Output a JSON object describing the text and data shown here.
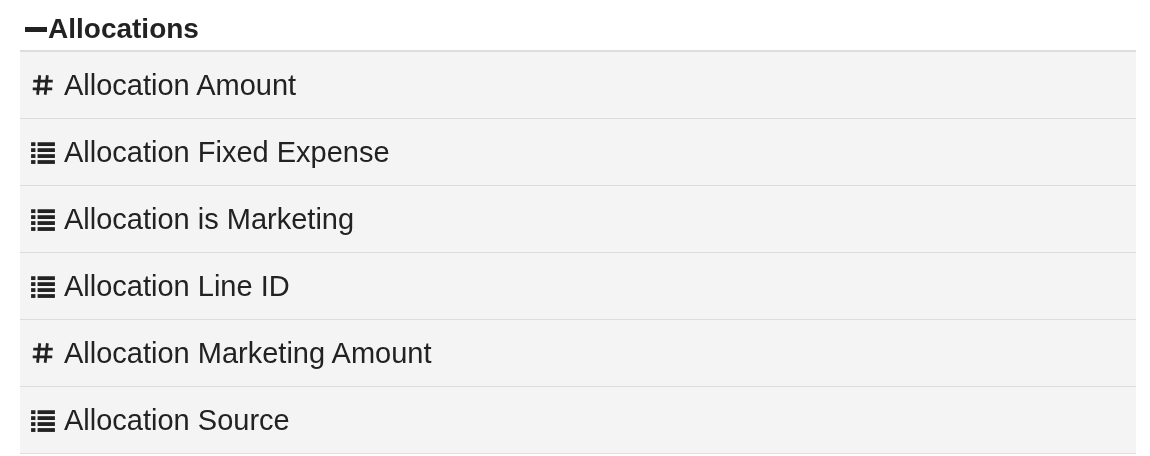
{
  "section": {
    "title": "Allocations",
    "expanded": true
  },
  "fields": [
    {
      "kind": "number",
      "label": "Allocation Amount"
    },
    {
      "kind": "list",
      "label": "Allocation Fixed Expense"
    },
    {
      "kind": "list",
      "label": "Allocation is Marketing"
    },
    {
      "kind": "list",
      "label": "Allocation Line ID"
    },
    {
      "kind": "number",
      "label": "Allocation Marketing Amount"
    },
    {
      "kind": "list",
      "label": "Allocation Source"
    }
  ]
}
